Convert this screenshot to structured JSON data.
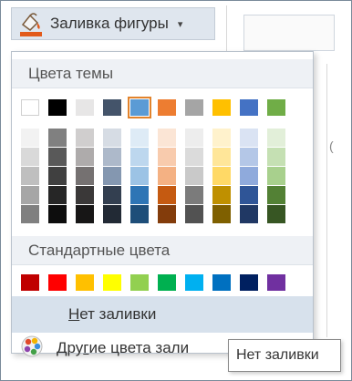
{
  "ribbon": {
    "button_label": "Заливка фигуры",
    "caret": "▾",
    "icon": "paint-bucket-icon"
  },
  "menu": {
    "theme_colors_header": "Цвета темы",
    "theme_colors": [
      "#ffffff",
      "#000000",
      "#e7e6e6",
      "#44546a",
      "#5b9bd5",
      "#ed7d31",
      "#a5a5a5",
      "#ffc000",
      "#4472c4",
      "#70ad47"
    ],
    "selected_theme_color": "#5b9bd5",
    "shades": [
      [
        "#f2f2f2",
        "#d9d9d9",
        "#bfbfbf",
        "#a6a6a6",
        "#808080"
      ],
      [
        "#808080",
        "#595959",
        "#404040",
        "#262626",
        "#0d0d0d"
      ],
      [
        "#d0cece",
        "#aeabab",
        "#757171",
        "#3a3838",
        "#171616"
      ],
      [
        "#d6dce4",
        "#adb9ca",
        "#8497b0",
        "#333f50",
        "#222a35"
      ],
      [
        "#deebf6",
        "#bdd7ee",
        "#9cc3e5",
        "#2e75b5",
        "#1e4e79"
      ],
      [
        "#fbe5d5",
        "#f8cbad",
        "#f4b183",
        "#c55a11",
        "#833c0b"
      ],
      [
        "#ededed",
        "#dbdbdb",
        "#c9c9c9",
        "#7b7b7b",
        "#525252"
      ],
      [
        "#fff2cc",
        "#ffe699",
        "#ffd966",
        "#bf9000",
        "#7f6000"
      ],
      [
        "#dae3f3",
        "#b4c7e7",
        "#8faadc",
        "#2f5597",
        "#203864"
      ],
      [
        "#e2efd9",
        "#c5e0b3",
        "#a8d08d",
        "#538135",
        "#375623"
      ]
    ],
    "standard_colors_header": "Стандартные цвета",
    "standard_colors": [
      "#c00000",
      "#ff0000",
      "#ffc000",
      "#ffff00",
      "#92d050",
      "#00b050",
      "#00b0f0",
      "#0070c0",
      "#002060",
      "#7030a0"
    ],
    "no_fill_prefix": "",
    "no_fill_underlined": "Н",
    "no_fill_rest": "ет заливки",
    "more_colors_prefix": "Дру",
    "more_colors_underlined": "г",
    "more_colors_rest": "ие цвета зали",
    "more_colors_icon": "color-palette-icon"
  },
  "tooltip": {
    "text": "Нет заливки"
  },
  "side": {
    "mark": "("
  }
}
